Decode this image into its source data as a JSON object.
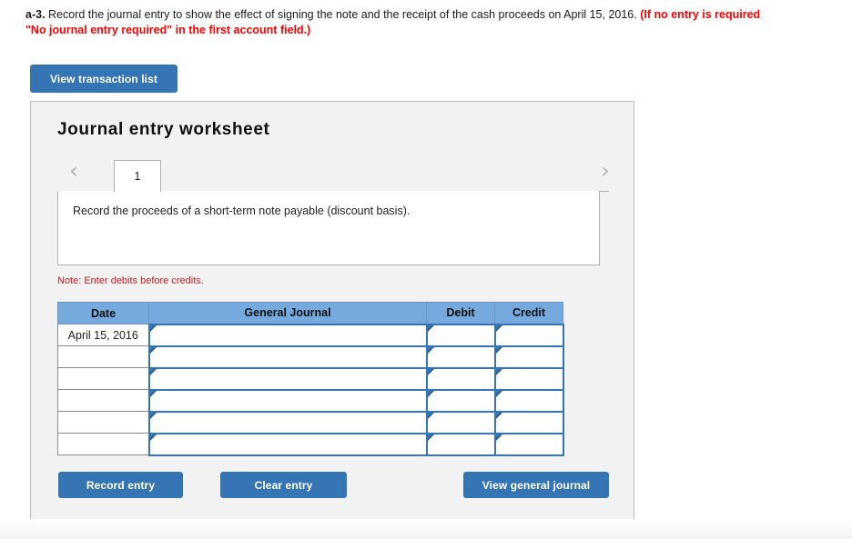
{
  "prompt": {
    "label": "a-3.",
    "line1_black": " Record the journal entry to show the effect of signing the note and the receipt of the cash proceeds on April 15, 2016. ",
    "line1_red": "(If no entry is required",
    "line2_red": "\"No journal entry required\" in the first account field.)"
  },
  "toolbar": {
    "view_transaction_list": "View transaction list"
  },
  "worksheet": {
    "title": "Journal entry worksheet",
    "prev_arrow": "‹",
    "next_arrow": "›",
    "tabs": [
      {
        "label": "1",
        "active": true
      }
    ],
    "description": "Record the proceeds of a short-term note payable (discount basis).",
    "note": "Note: Enter debits before credits."
  },
  "table": {
    "headers": [
      "Date",
      "General Journal",
      "Debit",
      "Credit"
    ],
    "rows": [
      {
        "date": "April 15, 2016",
        "general_journal": "",
        "debit": "",
        "credit": ""
      },
      {
        "date": "",
        "general_journal": "",
        "debit": "",
        "credit": ""
      },
      {
        "date": "",
        "general_journal": "",
        "debit": "",
        "credit": ""
      },
      {
        "date": "",
        "general_journal": "",
        "debit": "",
        "credit": ""
      },
      {
        "date": "",
        "general_journal": "",
        "debit": "",
        "credit": ""
      },
      {
        "date": "",
        "general_journal": "",
        "debit": "",
        "credit": ""
      }
    ]
  },
  "footer": {
    "record_entry": "Record entry",
    "clear_entry": "Clear entry",
    "view_general_journal": "View general journal"
  },
  "colors": {
    "button_blue": "#3575b4",
    "header_blue": "#76a9dd",
    "input_border_blue": "#3575b4",
    "note_red": "#c0201f",
    "prompt_red": "#ff0000",
    "panel_bg": "#f2f2f2"
  }
}
